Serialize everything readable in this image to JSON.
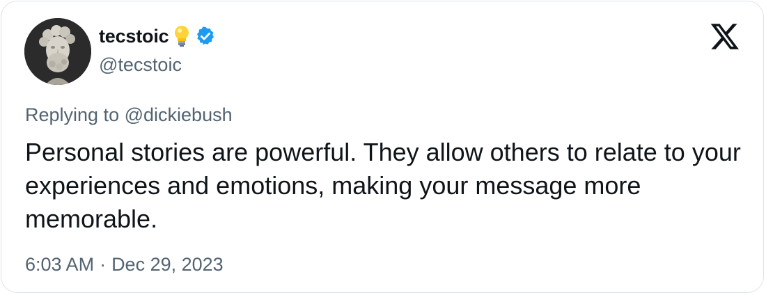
{
  "author": {
    "display_name": "tecstoic",
    "handle": "@tecstoic",
    "avatar_icon": "marcus-aurelius-bust-avatar",
    "emoji_icon": "light-bulb-icon",
    "verified_icon": "verified-badge-icon",
    "verified_color": "#1d9bf0"
  },
  "platform_logo": "x-logo-icon",
  "reply": {
    "prefix": "Replying to",
    "mention": "@dickiebush"
  },
  "tweet": {
    "text": "Personal stories are powerful. They allow others to relate to your experiences and emotions, making your message more memorable."
  },
  "meta": {
    "time": "6:03 AM",
    "separator": "·",
    "date": "Dec 29, 2023"
  },
  "colors": {
    "text_primary": "#0f1419",
    "text_secondary": "#536471",
    "border": "#dfe3e8"
  }
}
